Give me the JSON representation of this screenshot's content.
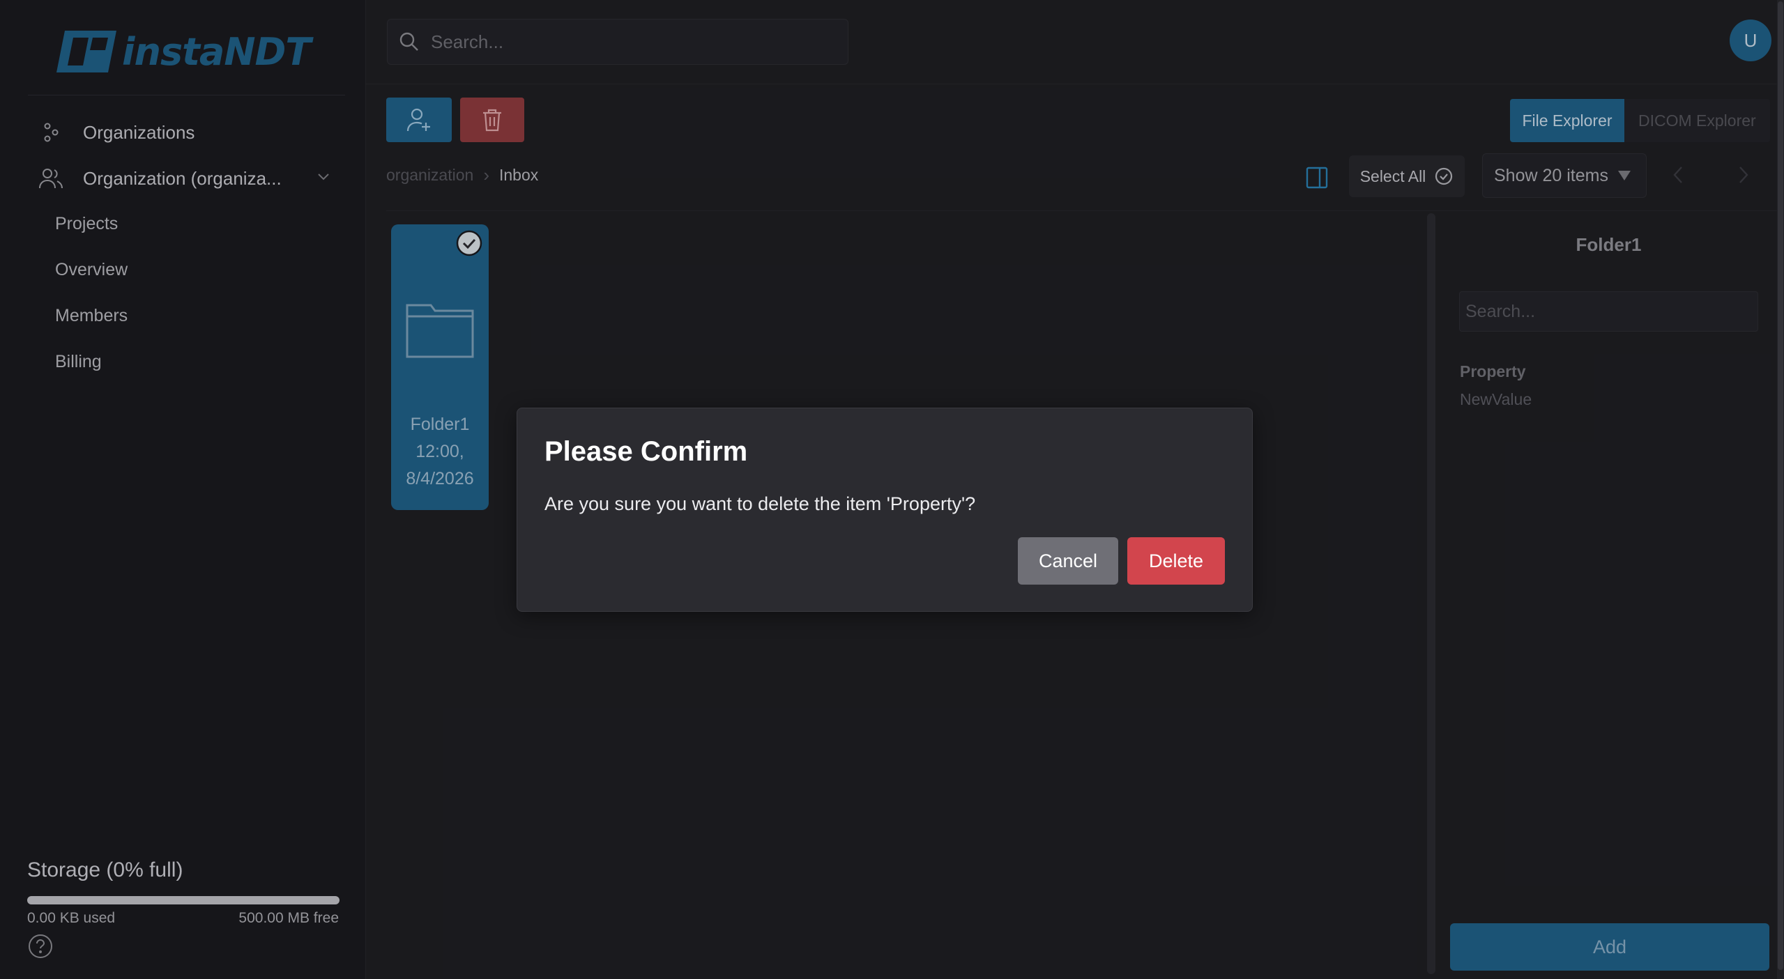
{
  "app": {
    "logo_text": "instaNDT"
  },
  "sidebar": {
    "nav": [
      {
        "label": "Organizations",
        "icon": "organizations-icon"
      },
      {
        "label": "Organization (organiza...",
        "icon": "users-icon"
      }
    ],
    "sub_items": [
      "Projects",
      "Overview",
      "Members",
      "Billing"
    ],
    "storage": {
      "title": "Storage (0% full)",
      "used": "0.00 KB used",
      "free": "500.00 MB free",
      "percent_full": 0
    }
  },
  "header": {
    "search_placeholder": "Search...",
    "avatar_initial": "U"
  },
  "toolbar": {
    "tabs": [
      {
        "label": "File Explorer",
        "active": true
      },
      {
        "label": "DICOM Explorer",
        "active": false
      }
    ],
    "breadcrumb": [
      "organization",
      "Inbox"
    ],
    "select_all_label": "Select All",
    "page_size_label": "Show 20 items"
  },
  "content": {
    "items": [
      {
        "name": "Folder1",
        "time": "12:00,",
        "date": "8/4/2026",
        "selected": true
      }
    ]
  },
  "details_panel": {
    "title": "Folder1",
    "search_placeholder": "Search...",
    "property_key": "Property",
    "property_value": "NewValue",
    "add_label": "Add"
  },
  "modal": {
    "title": "Please Confirm",
    "message": "Are you sure you want to delete the item 'Property'?",
    "cancel_label": "Cancel",
    "delete_label": "Delete"
  },
  "colors": {
    "accent": "#1f5f86",
    "danger": "#d2454d",
    "background": "#1e1e22",
    "sidebar": "#1a1a1e"
  }
}
